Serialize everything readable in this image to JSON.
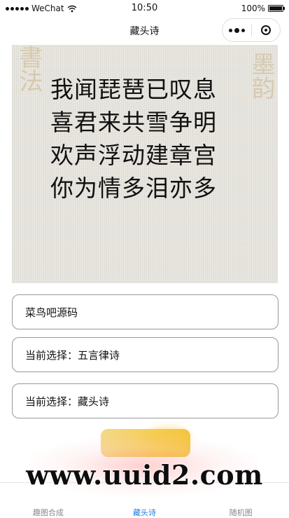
{
  "status_bar": {
    "carrier": "WeChat",
    "time": "10:50",
    "battery": "100%"
  },
  "nav": {
    "title": "藏头诗"
  },
  "poem": {
    "lines": [
      "我闻琵琶已叹息",
      "喜君来共雪争明",
      "欢声浮动建章宫",
      "你为情多泪亦多"
    ]
  },
  "form": {
    "input_value": "菜鸟吧源码",
    "choice_1": "当前选择：五言律诗",
    "choice_2": "当前选择：藏头诗"
  },
  "tabs": [
    {
      "label": "趣图合成",
      "active": false
    },
    {
      "label": "藏头诗",
      "active": true
    },
    {
      "label": "随机图",
      "active": false
    }
  ],
  "watermark": {
    "text": "www.uuid2.com"
  },
  "colors": {
    "accent": "#1e7fe0",
    "button": "#f6cd54"
  }
}
